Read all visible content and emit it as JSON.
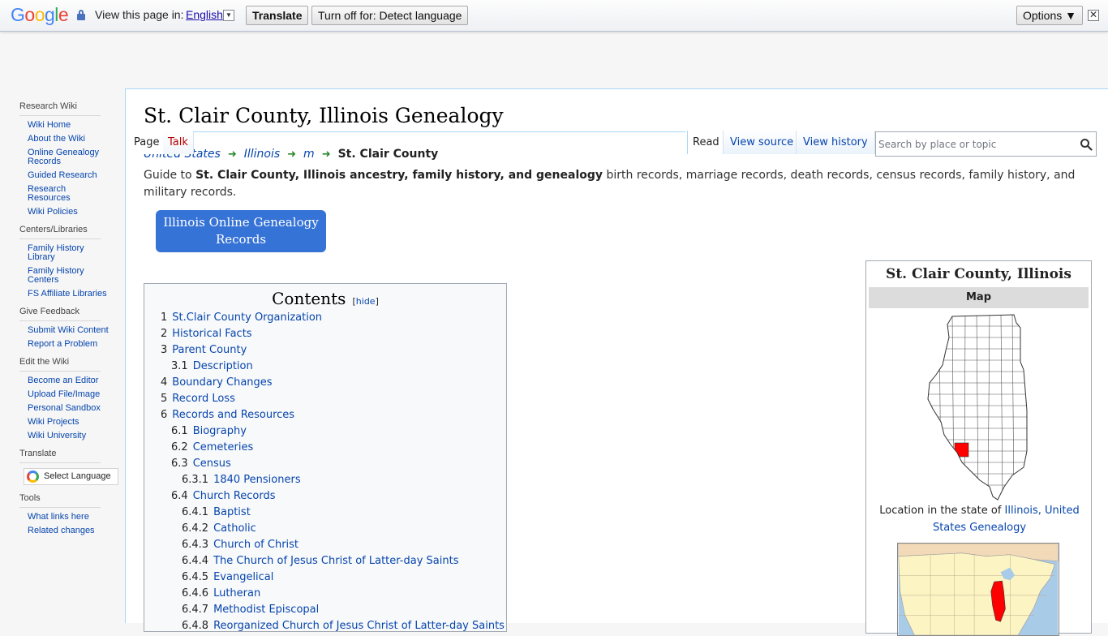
{
  "translate_bar": {
    "logo": "Google",
    "view_label": "View this page in:",
    "language": "English",
    "translate_button": "Translate",
    "turn_off_button": "Turn off for: Detect language",
    "options_button": "Options ▼",
    "close_glyph": "✕"
  },
  "sidebar": {
    "sections": [
      {
        "heading": "Research Wiki",
        "items": [
          "Wiki Home",
          "About the Wiki",
          "Online Genealogy Records",
          "Guided Research",
          "Research Resources",
          "Wiki Policies"
        ]
      },
      {
        "heading": "Centers/Libraries",
        "items": [
          "Family History Library",
          "Family History Centers",
          "FS Affiliate Libraries"
        ]
      },
      {
        "heading": "Give Feedback",
        "items": [
          "Submit Wiki Content",
          "Report a Problem"
        ]
      },
      {
        "heading": "Edit the Wiki",
        "items": [
          "Become an Editor",
          "Upload File/Image",
          "Personal Sandbox",
          "Wiki Projects",
          "Wiki University"
        ]
      },
      {
        "heading": "Translate",
        "widget_label": "Select Language"
      },
      {
        "heading": "Tools",
        "items": [
          "What links here",
          "Related changes"
        ]
      }
    ]
  },
  "tabs": {
    "page": "Page",
    "talk": "Talk",
    "read": "Read",
    "view_source": "View source",
    "view_history": "View history"
  },
  "search": {
    "placeholder": "Search by place or topic"
  },
  "page": {
    "title": "St. Clair County, Illinois Genealogy",
    "breadcrumb": [
      "United States",
      "Illinois",
      "m"
    ],
    "breadcrumb_current": "St. Clair County",
    "intro_prefix": "Guide to ",
    "intro_bold": "St. Clair County, Illinois ancestry, family history, and genealogy",
    "intro_rest": " birth records, marriage records, death records, census records, family history, and military records.",
    "records_button": "Illinois Online Genealogy Records"
  },
  "toc": {
    "title": "Contents",
    "hide": "hide",
    "items": [
      {
        "num": "1",
        "label": "St.Clair County Organization",
        "level": 1
      },
      {
        "num": "2",
        "label": "Historical Facts",
        "level": 1
      },
      {
        "num": "3",
        "label": "Parent County",
        "level": 1
      },
      {
        "num": "3.1",
        "label": "Description",
        "level": 2
      },
      {
        "num": "4",
        "label": "Boundary Changes",
        "level": 1
      },
      {
        "num": "5",
        "label": "Record Loss",
        "level": 1
      },
      {
        "num": "6",
        "label": "Records and Resources",
        "level": 1
      },
      {
        "num": "6.1",
        "label": "Biography",
        "level": 2
      },
      {
        "num": "6.2",
        "label": "Cemeteries",
        "level": 2
      },
      {
        "num": "6.3",
        "label": "Census",
        "level": 2
      },
      {
        "num": "6.3.1",
        "label": "1840 Pensioners",
        "level": 3
      },
      {
        "num": "6.4",
        "label": "Church Records",
        "level": 2
      },
      {
        "num": "6.4.1",
        "label": "Baptist",
        "level": 3
      },
      {
        "num": "6.4.2",
        "label": "Catholic",
        "level": 3
      },
      {
        "num": "6.4.3",
        "label": "Church of Christ",
        "level": 3
      },
      {
        "num": "6.4.4",
        "label": "The Church of Jesus Christ of Latter-day Saints",
        "level": 3
      },
      {
        "num": "6.4.5",
        "label": "Evangelical",
        "level": 3
      },
      {
        "num": "6.4.6",
        "label": "Lutheran",
        "level": 3
      },
      {
        "num": "6.4.7",
        "label": "Methodist Episcopal",
        "level": 3
      },
      {
        "num": "6.4.8",
        "label": "Reorganized Church of Jesus Christ of Latter-day Saints",
        "level": 3
      }
    ]
  },
  "infobox": {
    "title": "St. Clair County, Illinois",
    "map_label": "Map",
    "caption_prefix": "Location in the state of ",
    "caption_link": "Illinois, United States Genealogy"
  },
  "colors": {
    "link": "#0645ad",
    "talk_red": "#ba0000",
    "button_blue": "#3673d6",
    "highlight_red": "#ff0000",
    "arrow_green": "#2a8a2a"
  }
}
